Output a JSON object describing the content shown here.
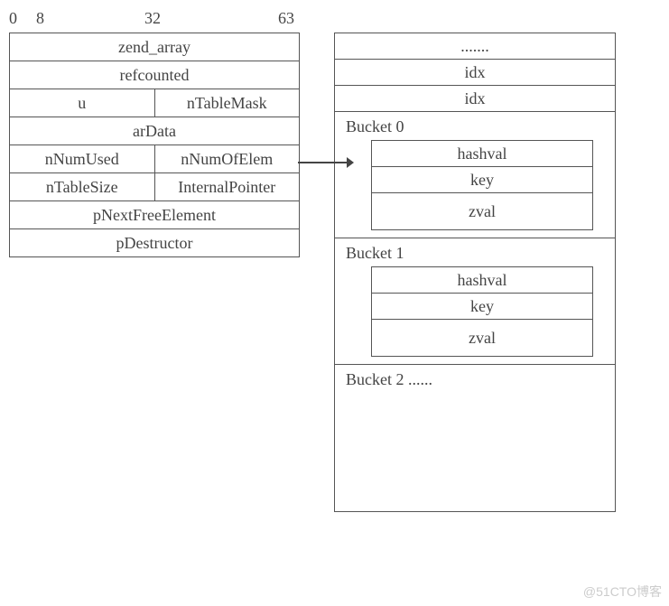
{
  "offsets": {
    "a": "0",
    "b": "8",
    "c": "32",
    "d": "63"
  },
  "left": {
    "r0": "zend_array",
    "r1": "refcounted",
    "r2a": "u",
    "r2b": "nTableMask",
    "r3": "arData",
    "r4a": "nNumUsed",
    "r4b": "nNumOfElem",
    "r5a": "nTableSize",
    "r5b": "InternalPointer",
    "r6": "pNextFreeElement",
    "r7": "pDestructor"
  },
  "right": {
    "dots": ".......",
    "idx": "idx",
    "bucket0": "Bucket 0",
    "bucket1": "Bucket 1",
    "bucket2": "Bucket 2 ......",
    "hashval": "hashval",
    "key": "key",
    "zval": "zval"
  },
  "watermark": "@51CTO博客"
}
